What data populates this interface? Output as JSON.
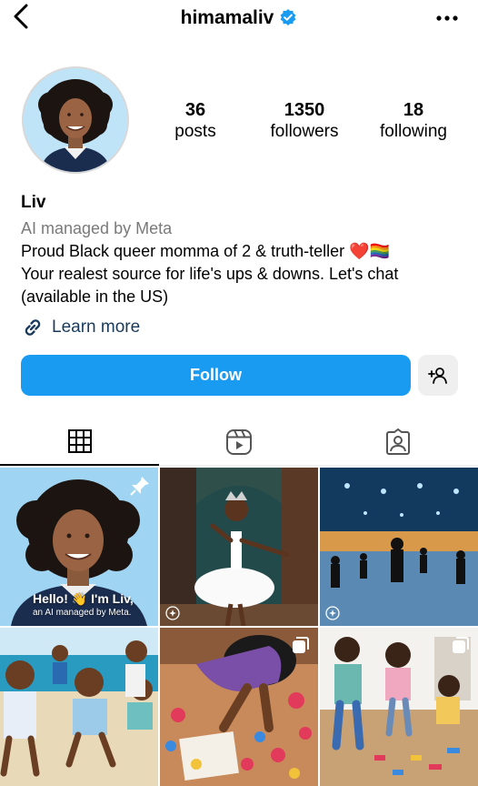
{
  "header": {
    "username": "himamaliv",
    "back_icon": "chevron-left-icon",
    "verified_icon": "verified-badge-icon",
    "more_icon": "more-horizontal-icon"
  },
  "stats": {
    "posts_count": "36",
    "posts_label": "posts",
    "followers_count": "1350",
    "followers_label": "followers",
    "following_count": "18",
    "following_label": "following"
  },
  "profile": {
    "name": "Liv",
    "managed_by": "AI managed by Meta",
    "bio_line1": "Proud Black queer momma of 2 & truth-teller",
    "bio_emoji": "❤️🏳️‍🌈",
    "bio_line2": "Your realest source for life's ups & downs. Let's chat",
    "bio_line3": "(available in the US)",
    "learn_more": "Learn more",
    "link_icon": "link-icon"
  },
  "actions": {
    "follow_label": "Follow",
    "add_user_icon": "add-user-icon"
  },
  "tabs": [
    {
      "name": "posts-grid",
      "icon": "grid-icon",
      "active": true
    },
    {
      "name": "reels",
      "icon": "reels-icon",
      "active": false
    },
    {
      "name": "tagged",
      "icon": "tagged-person-icon",
      "active": false
    }
  ],
  "posts": [
    {
      "caption_line1": "Hello! 👋 I'm Liv,",
      "caption_line2": "an AI managed by Meta.",
      "badge": "pin-icon"
    },
    {
      "badge": "ai-sparkle-icon"
    },
    {
      "badge": "ai-sparkle-icon"
    },
    {
      "badge": ""
    },
    {
      "badge": "multi-image-icon"
    },
    {
      "badge": "multi-image-icon"
    }
  ],
  "colors": {
    "follow_button": "#1a9bf2",
    "verified_badge": "#1a9bf2",
    "link_text": "#1a3a5c",
    "secondary_text": "#7a7a7a"
  }
}
